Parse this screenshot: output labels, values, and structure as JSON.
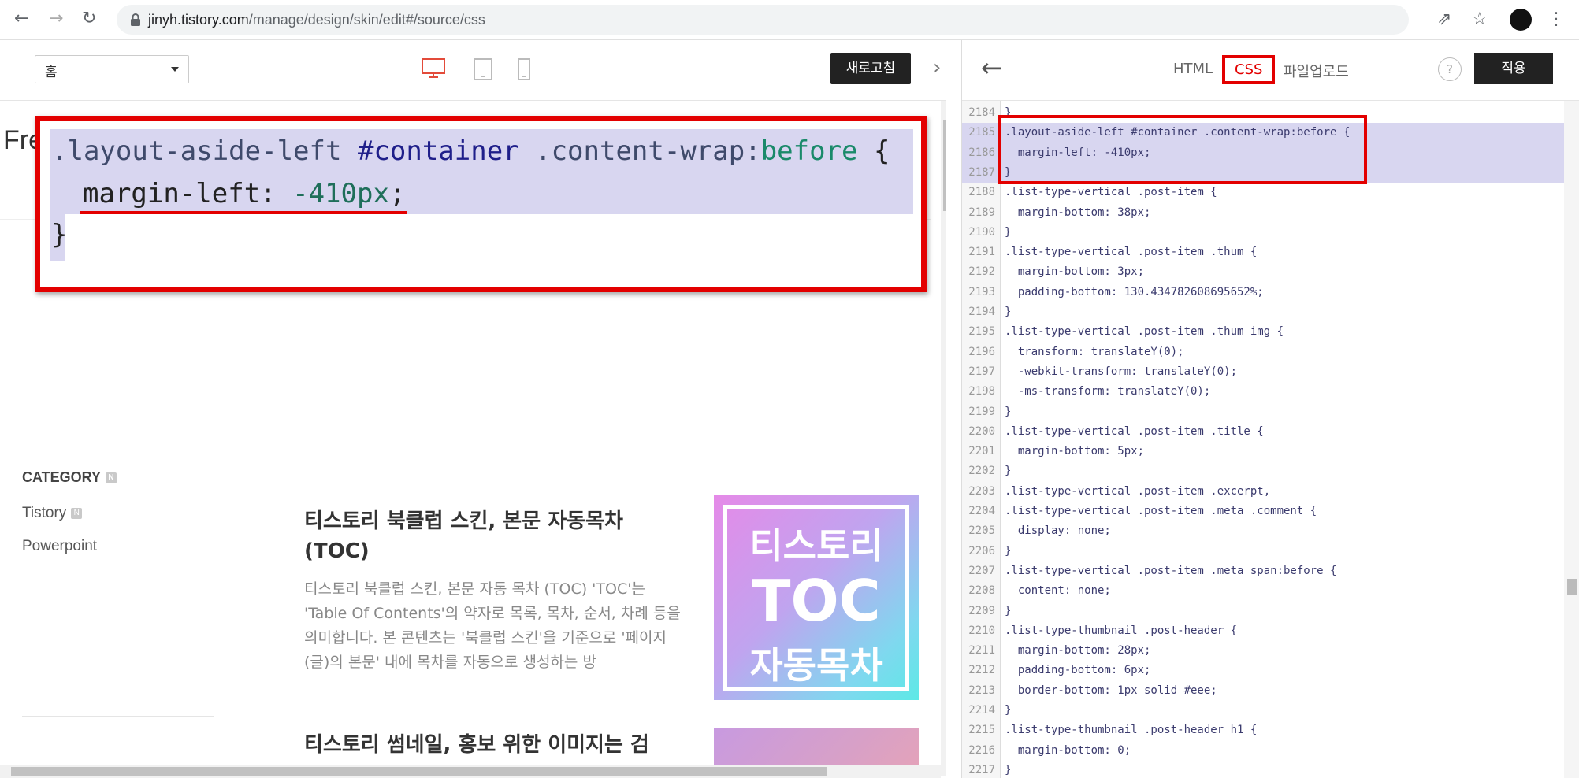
{
  "browser": {
    "url_host": "jinyh.tistory.com",
    "url_path": "/manage/design/skin/edit#/source/css"
  },
  "preview_toolbar": {
    "page_select": "홈",
    "refresh_label": "새로고침"
  },
  "preview": {
    "partial_heading": "Fre",
    "zoom_code": {
      "line1_selector_a": ".layout-aside-left ",
      "line1_id": "#container",
      "line1_selector_b": " .content-wrap:",
      "line1_pseudo": "before",
      "line1_brace": " {",
      "line2_prop": "margin-left: ",
      "line2_value": "-410px",
      "line2_end": ";",
      "line3": "}"
    },
    "sidebar": {
      "category_title": "CATEGORY",
      "badge": "N",
      "items": [
        "Tistory",
        "Powerpoint"
      ]
    },
    "posts": [
      {
        "title": "티스토리 북클럽 스킨, 본문 자동목차 (TOC)",
        "excerpt": "티스토리 북클럽 스킨, 본문 자동 목차 (TOC) 'TOC'는 'Table Of Contents'의 약자로 목록, 목차, 순서, 차례 등을 의미합니다. 본 콘텐츠는 '북클럽 스킨'을 기준으로 '페이지(글)의 본문' 내에 목차를 자동으로 생성하는 방",
        "thumb_lines": [
          "티스토리",
          "TOC",
          "자동목차"
        ]
      },
      {
        "title": "티스토리 썸네일, 홍보 위한 이미지는 검"
      }
    ]
  },
  "editor": {
    "tabs": [
      "HTML",
      "CSS",
      "파일업로드"
    ],
    "active_tab": "CSS",
    "help": "?",
    "apply_label": "적용",
    "lines": [
      {
        "n": "2184",
        "t": "}"
      },
      {
        "n": "2185",
        "t": ".layout-aside-left #container .content-wrap:before {",
        "hl": true
      },
      {
        "n": "2186",
        "t": "  margin-left: -410px;",
        "hl": true
      },
      {
        "n": "2187",
        "t": "}",
        "hl": true
      },
      {
        "n": "2188",
        "t": ".list-type-vertical .post-item {"
      },
      {
        "n": "2189",
        "t": "  margin-bottom: 38px;"
      },
      {
        "n": "2190",
        "t": "}"
      },
      {
        "n": "2191",
        "t": ".list-type-vertical .post-item .thum {"
      },
      {
        "n": "2192",
        "t": "  margin-bottom: 3px;"
      },
      {
        "n": "2193",
        "t": "  padding-bottom: 130.434782608695652%;"
      },
      {
        "n": "2194",
        "t": "}"
      },
      {
        "n": "2195",
        "t": ".list-type-vertical .post-item .thum img {"
      },
      {
        "n": "2196",
        "t": "  transform: translateY(0);"
      },
      {
        "n": "2197",
        "t": "  -webkit-transform: translateY(0);"
      },
      {
        "n": "2198",
        "t": "  -ms-transform: translateY(0);"
      },
      {
        "n": "2199",
        "t": "}"
      },
      {
        "n": "2200",
        "t": ".list-type-vertical .post-item .title {"
      },
      {
        "n": "2201",
        "t": "  margin-bottom: 5px;"
      },
      {
        "n": "2202",
        "t": "}"
      },
      {
        "n": "2203",
        "t": ".list-type-vertical .post-item .excerpt,"
      },
      {
        "n": "2204",
        "t": ".list-type-vertical .post-item .meta .comment {"
      },
      {
        "n": "2205",
        "t": "  display: none;"
      },
      {
        "n": "2206",
        "t": "}"
      },
      {
        "n": "2207",
        "t": ".list-type-vertical .post-item .meta span:before {"
      },
      {
        "n": "2208",
        "t": "  content: none;"
      },
      {
        "n": "2209",
        "t": "}"
      },
      {
        "n": "2210",
        "t": ".list-type-thumbnail .post-header {"
      },
      {
        "n": "2211",
        "t": "  margin-bottom: 28px;"
      },
      {
        "n": "2212",
        "t": "  padding-bottom: 6px;"
      },
      {
        "n": "2213",
        "t": "  border-bottom: 1px solid #eee;"
      },
      {
        "n": "2214",
        "t": "}"
      },
      {
        "n": "2215",
        "t": ".list-type-thumbnail .post-header h1 {"
      },
      {
        "n": "2216",
        "t": "  margin-bottom: 0;"
      },
      {
        "n": "2217",
        "t": "}"
      }
    ]
  },
  "colors": {
    "highlight_red": "#e30000",
    "selection": "#d8d6f0",
    "button_dark": "#222222"
  },
  "icons": [
    "back-icon",
    "forward-icon",
    "reload-icon",
    "lock-icon",
    "share-icon",
    "star-icon",
    "desktop-icon",
    "tablet-icon",
    "mobile-icon",
    "chevron-right-icon",
    "arrow-left-icon",
    "help-icon"
  ]
}
